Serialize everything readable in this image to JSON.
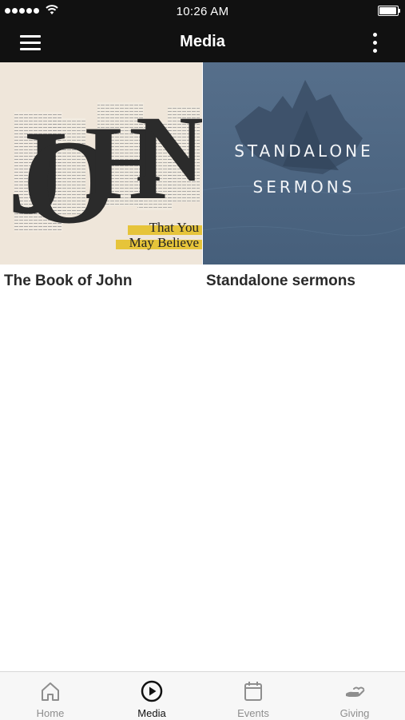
{
  "status_bar": {
    "time": "10:26 AM",
    "signal_icon": "signal-dots-icon",
    "wifi_icon": "wifi-icon",
    "battery_icon": "battery-icon"
  },
  "nav": {
    "title": "Media",
    "menu_icon": "hamburger-menu-icon",
    "more_icon": "vertical-ellipsis-icon"
  },
  "media_items": [
    {
      "title": "The Book of John",
      "artwork": {
        "letters": [
          "J",
          "O",
          "H",
          "N"
        ],
        "tagline": [
          "That You",
          "May Believe"
        ],
        "highlight_color": "#e6c43a"
      }
    },
    {
      "title": "Standalone sermons",
      "artwork": {
        "lines": [
          "STANDALONE",
          "SERMONS"
        ],
        "background_color": "#4d6783"
      }
    }
  ],
  "tabs": [
    {
      "label": "Home",
      "icon": "home-icon",
      "active": false
    },
    {
      "label": "Media",
      "icon": "play-circle-icon",
      "active": true
    },
    {
      "label": "Events",
      "icon": "calendar-icon",
      "active": false
    },
    {
      "label": "Giving",
      "icon": "giving-hand-icon",
      "active": false
    }
  ],
  "colors": {
    "bar_background": "#111111",
    "tab_active": "#111111",
    "tab_inactive": "#8e8e8e"
  }
}
